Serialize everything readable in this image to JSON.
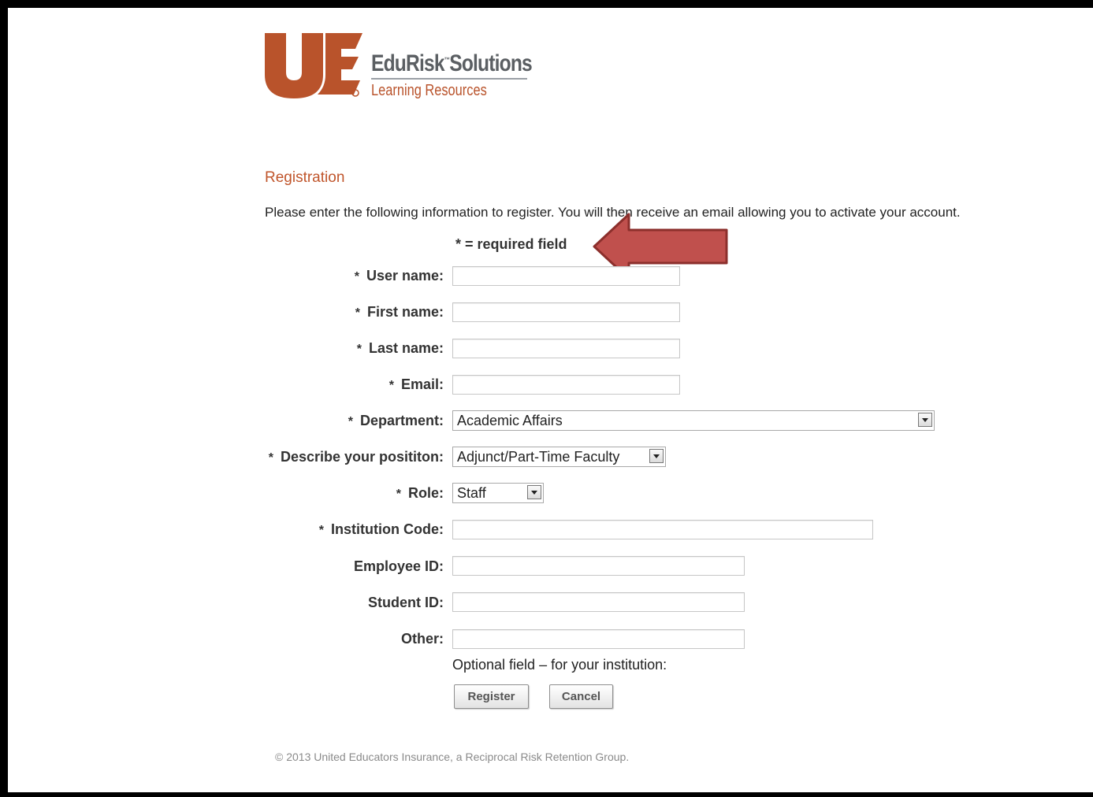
{
  "brand": {
    "name": "EduRisk",
    "name_tm": "™",
    "name_suffix": "Solutions",
    "subtitle": "Learning Resources",
    "logo_color": "#b9532b"
  },
  "page": {
    "title": "Registration",
    "intro": "Please enter the following information to register. You will then receive an email allowing you to activate your account.",
    "required_note": "* = required field"
  },
  "form": {
    "fields": [
      {
        "label": "User name:",
        "required": true,
        "value": ""
      },
      {
        "label": "First name:",
        "required": true,
        "value": ""
      },
      {
        "label": "Last name:",
        "required": true,
        "value": ""
      },
      {
        "label": "Email:",
        "required": true,
        "value": ""
      },
      {
        "label": "Department:",
        "required": true,
        "value": "Academic Affairs"
      },
      {
        "label": "Describe your posititon:",
        "required": true,
        "value": "Adjunct/Part-Time Faculty"
      },
      {
        "label": "Role:",
        "required": true,
        "value": "Staff"
      },
      {
        "label": "Institution Code:",
        "required": true,
        "value": ""
      },
      {
        "label": "Employee ID:",
        "required": false,
        "value": ""
      },
      {
        "label": "Student ID:",
        "required": false,
        "value": ""
      },
      {
        "label": "Other:",
        "required": false,
        "value": ""
      }
    ],
    "star": "*",
    "optional_note": "Optional field – for your institution:",
    "register_label": "Register",
    "cancel_label": "Cancel"
  },
  "annotation": {
    "arrow_color": "#c0504d",
    "arrow_outline": "#8c2f2c"
  },
  "footer": {
    "copyright": "© 2013 United Educators Insurance, a Reciprocal Risk Retention Group."
  }
}
